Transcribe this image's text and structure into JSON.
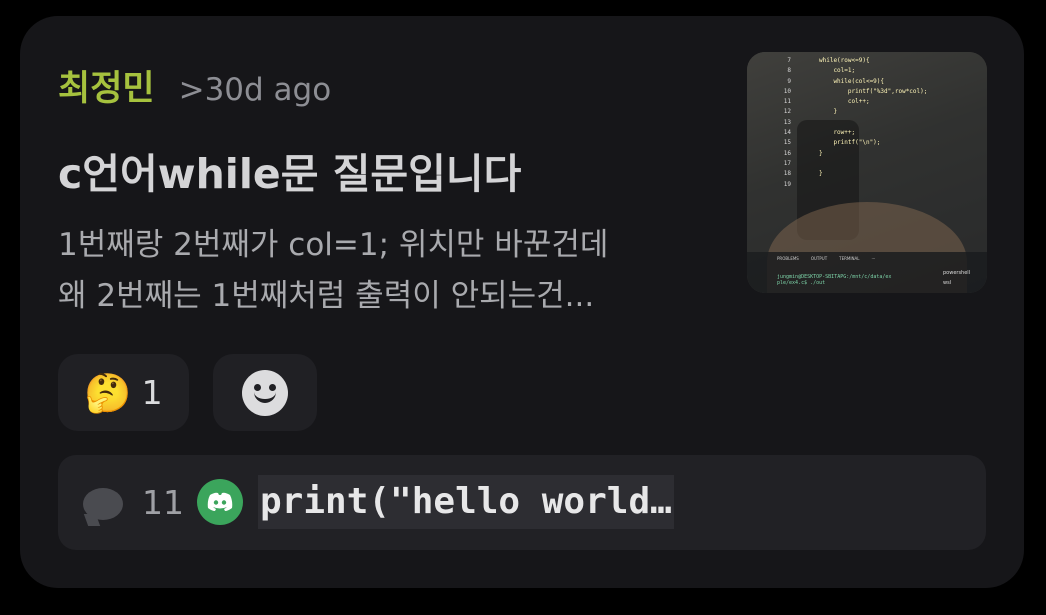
{
  "post": {
    "author": "최정민",
    "time": ">30d ago",
    "title": "c언어while문 질문입니다",
    "preview_lines": [
      "1번째랑 2번째가 col=1; 위치만 바꾼건데",
      "왜 2번째는 1번째처럼 출력이 안되는건..."
    ],
    "thumbnail": {
      "line_numbers": [
        "7",
        "8",
        "9",
        "10",
        "11",
        "12",
        "13",
        "14",
        "15",
        "16",
        "17",
        "18",
        "19"
      ],
      "code_lines": [
        "while(row<=9){",
        "    col=1;",
        "    while(col<=9){",
        "        printf(\"%3d\",row*col);",
        "        col++;",
        "    }",
        "",
        "    row++;",
        "    printf(\"\\n\");",
        "}",
        "",
        "}",
        ""
      ],
      "panel_tabs": [
        "PROBLEMS",
        "OUTPUT",
        "TERMINAL",
        "···"
      ],
      "prompt": "jungmin@DESKTOP-SBITAPG:/mnt/c/data/ex",
      "prompt2": "ple/ex4.c$ ./out",
      "side_items": [
        "powershell",
        "wsl"
      ]
    }
  },
  "reactions": [
    {
      "icon": "thinking-face-icon",
      "emoji": "🤔",
      "count": "1"
    },
    {
      "icon": "add-reaction-icon"
    }
  ],
  "footer": {
    "reply_count": "11",
    "last_message": "print(\"hello world…"
  },
  "colors": {
    "author": "#a6c23e",
    "card_bg": "#161619",
    "pill_bg": "#202024",
    "discord_green": "#3ba55c"
  }
}
